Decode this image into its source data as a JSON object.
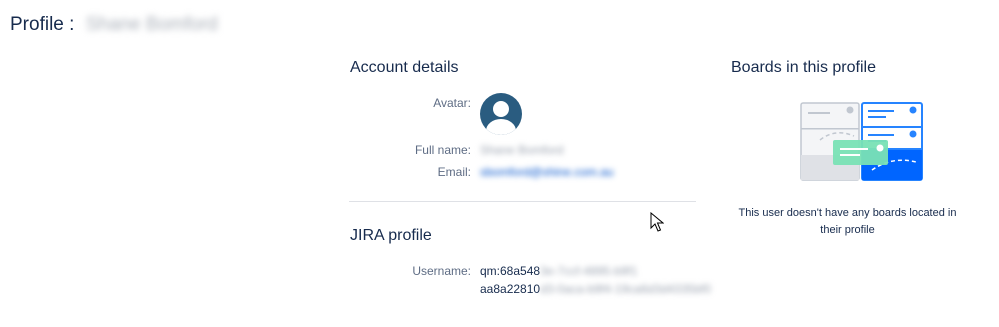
{
  "page": {
    "title_prefix": "Profile :",
    "user_name": "Shane Bomford"
  },
  "account": {
    "heading": "Account details",
    "avatar_label": "Avatar:",
    "fullname_label": "Full name:",
    "fullname_value": "Shane Bomford",
    "email_label": "Email:",
    "email_value": "sbomford@shine.com.au"
  },
  "jira": {
    "heading": "JIRA profile",
    "username_label": "Username:",
    "username_line1_visible": "qm:68a548",
    "username_line1_blurred": "3e-7ccf-4895-b9f1",
    "username_line2_visible": "aa8a22810",
    "username_line2_blurred": "d3-0aca-b9f4-19ca6d3d4335bf0"
  },
  "boards": {
    "heading": "Boards in this profile",
    "empty_message": "This user doesn't have any boards located in their profile"
  },
  "colors": {
    "link": "#0052cc",
    "accent_blue": "#2684ff",
    "green": "#57d9a3"
  }
}
